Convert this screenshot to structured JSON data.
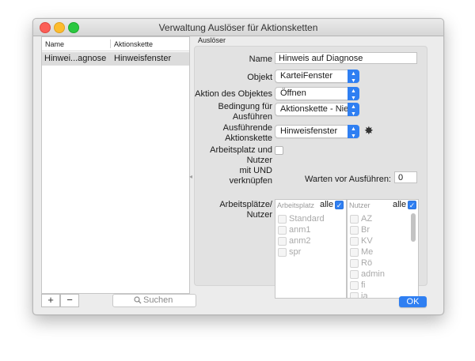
{
  "window": {
    "title": "Verwaltung Auslöser für Aktionsketten"
  },
  "list": {
    "columns": [
      "Name",
      "Aktionskette"
    ],
    "rows": [
      {
        "name": "Hinwei...agnose",
        "aktionskette": "Hinweisfenster"
      }
    ],
    "add_label": "+",
    "remove_label": "−",
    "search_placeholder": "Suchen",
    "search_icon": "magnifier-icon"
  },
  "panel": {
    "group_title": "Auslöser",
    "name_label": "Name",
    "name_value": "Hinweis auf Diagnose",
    "objekt_label": "Objekt",
    "objekt_value": "KarteiFenster",
    "aktion_label": "Aktion des Objektes",
    "aktion_value": "Öffnen",
    "bedingung_label_1": "Bedingung für",
    "bedingung_label_2": "Ausführen",
    "bedingung_value": "Aktionskette - Nie...",
    "ausfuehrende_label_1": "Ausführende",
    "ausfuehrende_label_2": "Aktionskette",
    "ausfuehrende_value": "Hinweisfenster",
    "gear_icon": "gear-icon",
    "arbeitsplatz_label_1": "Arbeitsplatz und",
    "arbeitsplatz_label_2": "Nutzer",
    "arbeitsplatz_label_3": "mit UND verknüpfen",
    "warten_label": "Warten vor Ausführen:",
    "warten_value": "0",
    "arbeitsplaetze_label_1": "Arbeitsplätze/",
    "arbeitsplaetze_label_2": "Nutzer",
    "arbeitsplatz_table": {
      "header": "Arbeitsplatz",
      "all_label": "alle",
      "items": [
        "Standard",
        "anm1",
        "anm2",
        "spr"
      ]
    },
    "nutzer_table": {
      "header": "Nutzer",
      "all_label": "alle",
      "items": [
        "AZ",
        "Br",
        "KV",
        "Me",
        "Rö",
        "admin",
        "fi",
        "ja"
      ]
    }
  },
  "footer": {
    "ok_label": "OK"
  },
  "colors": {
    "accent": "#2f7ff2",
    "selection": "#dcdcdc",
    "window_bg": "#ececec"
  }
}
